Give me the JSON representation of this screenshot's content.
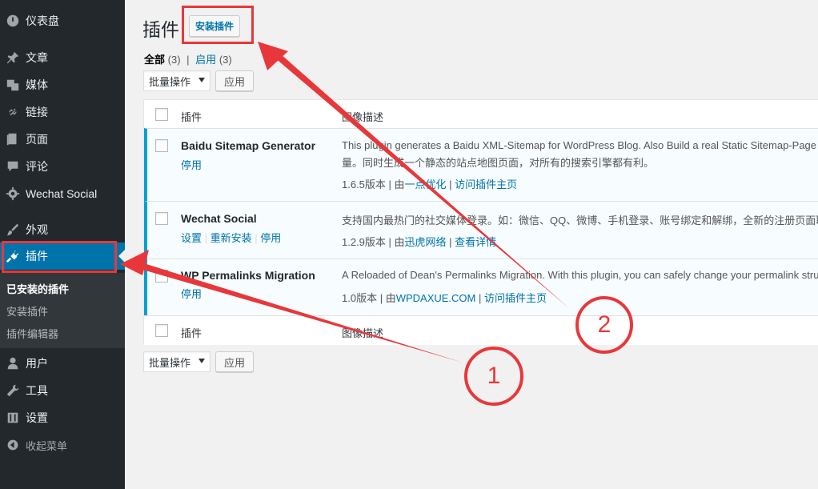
{
  "sidebar": {
    "items": [
      {
        "label": "仪表盘",
        "icon": "dashboard-icon"
      },
      {
        "label": "文章",
        "icon": "pin-icon"
      },
      {
        "label": "媒体",
        "icon": "media-icon"
      },
      {
        "label": "链接",
        "icon": "link-icon"
      },
      {
        "label": "页面",
        "icon": "page-icon"
      },
      {
        "label": "评论",
        "icon": "comment-icon"
      },
      {
        "label": "Wechat Social",
        "icon": "gear-icon"
      },
      {
        "label": "外观",
        "icon": "brush-icon"
      },
      {
        "label": "插件",
        "icon": "plugin-icon"
      },
      {
        "label": "用户",
        "icon": "user-icon"
      },
      {
        "label": "工具",
        "icon": "wrench-icon"
      },
      {
        "label": "设置",
        "icon": "settings-icon"
      }
    ],
    "submenu": [
      "已安装的插件",
      "安装插件",
      "插件编辑器"
    ],
    "collapse_label": "收起菜单"
  },
  "main": {
    "title": "插件",
    "add_new_label": "安装插件",
    "filters": {
      "all_label": "全部",
      "all_count": "(3)",
      "sep": "|",
      "active_label": "启用",
      "active_count": "(3)"
    },
    "bulk_action_label": "批量操作",
    "apply_label": "应用",
    "columns": {
      "plugin": "插件",
      "description": "图像描述"
    },
    "plugins": [
      {
        "name": "Baidu Sitemap Generator",
        "actions": [
          "停用"
        ],
        "desc_line1": "This plugin generates a Baidu XML-Sitemap for WordPress Blog. Also Build a real Static Sitemap-Page for all Search Engine.",
        "desc_line2": "量。同时生成一个静态的站点地图页面，对所有的搜索引擎都有利。",
        "version": "1.6.5版本",
        "by": "由",
        "author": "一点优化",
        "link": "访问插件主页"
      },
      {
        "name": "Wechat Social",
        "actions": [
          "设置",
          "重新安装",
          "停用"
        ],
        "desc_line1": "支持国内最热门的社交媒体登录。如：微信、QQ、微博、手机登录、账号绑定和解绑，全新的注册页面取代原生注册页面。",
        "desc_line2": "",
        "version": "1.2.9版本",
        "by": "由",
        "author": "迅虎网络",
        "link": "查看详情"
      },
      {
        "name": "WP Permalinks Migration",
        "actions": [
          "停用"
        ],
        "desc_line1": "A Reloaded of Dean's Permalinks Migration. With this plugin, you can safely change your permalink structure.",
        "desc_line2": "",
        "version": "1.0版本",
        "by": "由",
        "author": "WPDAXUE.COM",
        "link": "访问插件主页"
      }
    ]
  },
  "annotations": {
    "circle1": "1",
    "circle2": "2",
    "color": "#e8373a"
  }
}
